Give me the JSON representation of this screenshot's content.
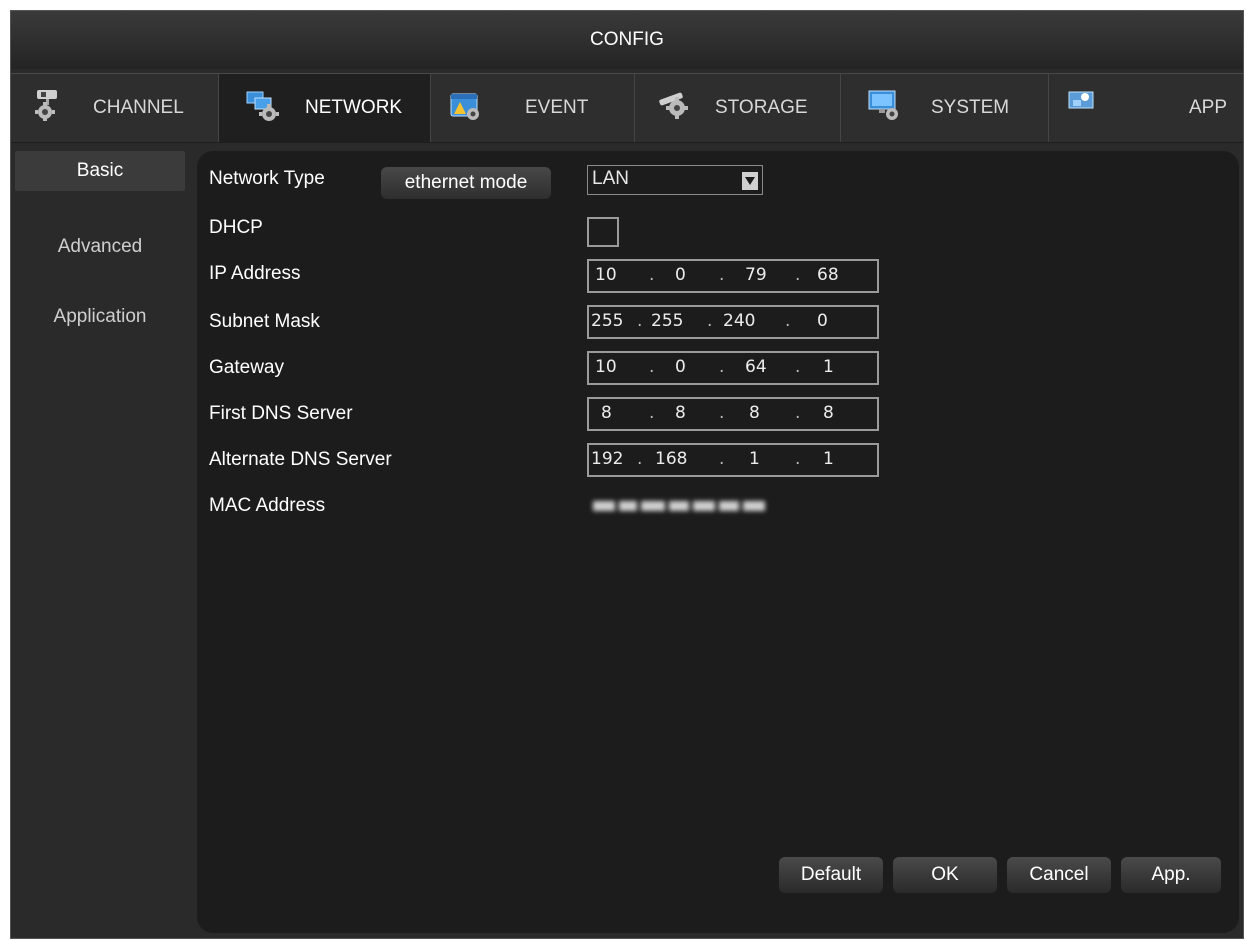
{
  "window": {
    "title": "CONFIG"
  },
  "tabs": [
    {
      "label": "CHANNEL",
      "icon": "camera-gear-icon"
    },
    {
      "label": "NETWORK",
      "icon": "network-gear-icon",
      "active": true
    },
    {
      "label": "EVENT",
      "icon": "alarm-gear-icon"
    },
    {
      "label": "STORAGE",
      "icon": "disk-gear-icon"
    },
    {
      "label": "SYSTEM",
      "icon": "monitor-gear-icon"
    },
    {
      "label": "APP",
      "icon": "app-icon"
    }
  ],
  "sidebar": {
    "items": [
      {
        "label": "Basic",
        "active": true
      },
      {
        "label": "Advanced"
      },
      {
        "label": "Application"
      }
    ]
  },
  "form": {
    "network_type": {
      "label": "Network Type",
      "mode_button": "ethernet mode",
      "value": "LAN"
    },
    "dhcp": {
      "label": "DHCP",
      "checked": false
    },
    "ip_address": {
      "label": "IP Address",
      "octets": [
        "10",
        "0",
        "79",
        "68"
      ]
    },
    "subnet_mask": {
      "label": "Subnet Mask",
      "octets": [
        "255",
        "255",
        "240",
        "0"
      ]
    },
    "gateway": {
      "label": "Gateway",
      "octets": [
        "10",
        "0",
        "64",
        "1"
      ]
    },
    "first_dns": {
      "label": "First DNS Server",
      "octets": [
        "8",
        "8",
        "8",
        "8"
      ]
    },
    "alternate_dns": {
      "label": "Alternate DNS Server",
      "octets": [
        "192",
        "168",
        "1",
        "1"
      ]
    },
    "mac_address": {
      "label": "MAC Address"
    }
  },
  "buttons": {
    "default": "Default",
    "ok": "OK",
    "cancel": "Cancel",
    "apply": "App."
  },
  "colors": {
    "window_bg": "#2a2a2a",
    "panel_bg": "#1c1c1c",
    "accent_icon_blue": "#3a8fd8",
    "text": "#ffffff"
  }
}
